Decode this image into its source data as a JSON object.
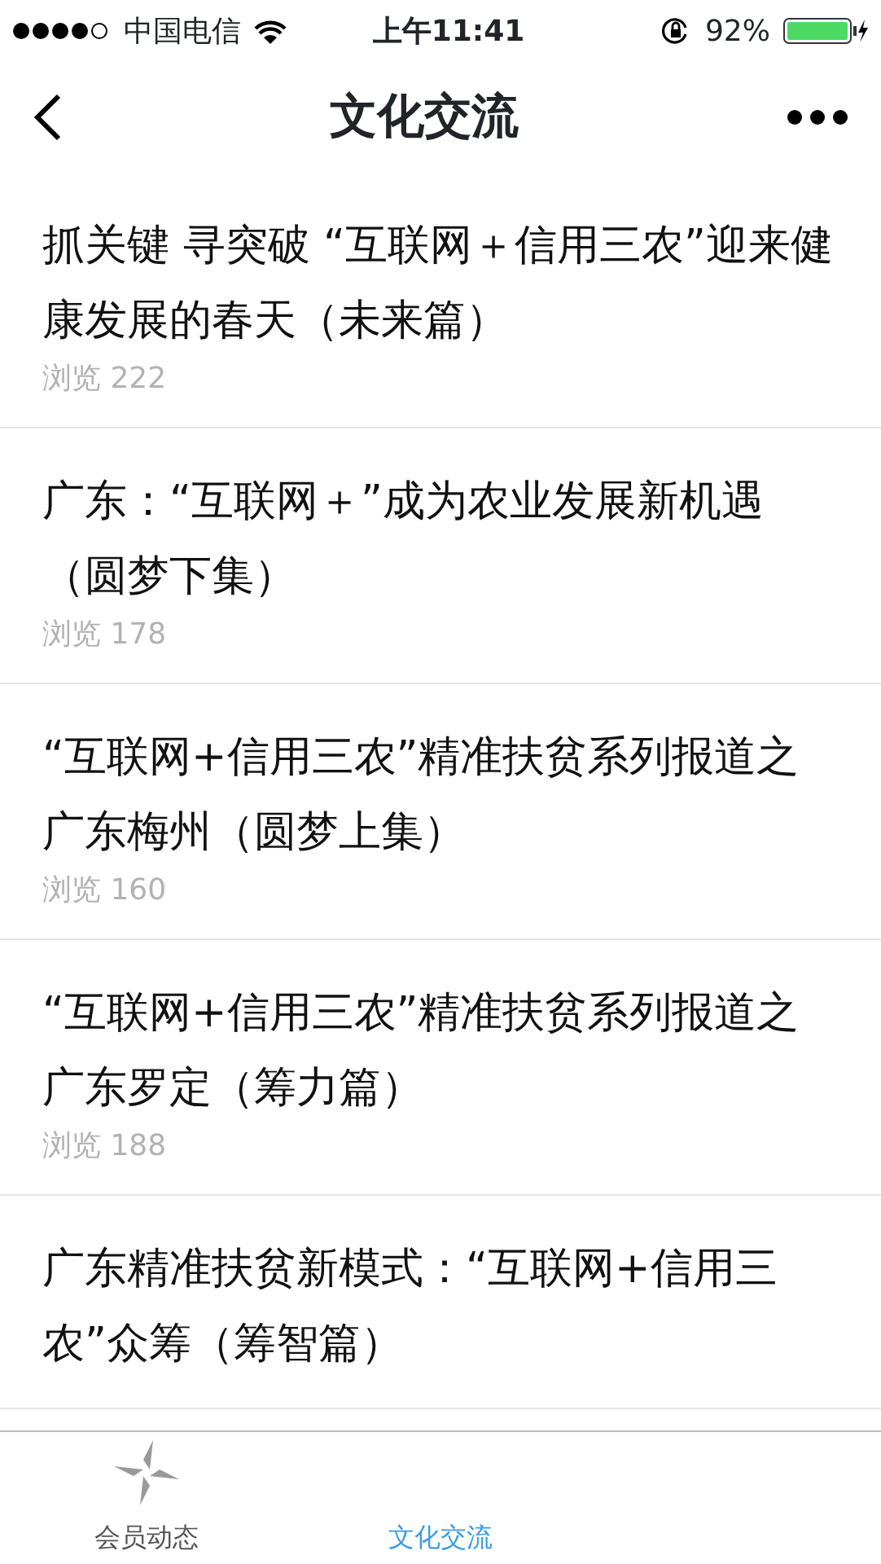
{
  "status_bar": {
    "carrier": "中国电信",
    "time": "上午11:41",
    "battery": "92%"
  },
  "nav": {
    "title": "文化交流"
  },
  "articles": [
    {
      "title": "抓关键 寻突破 “互联网＋信用三农”迎来健康发展的春天（未来篇）",
      "views": "浏览 222"
    },
    {
      "title": "广东：“互联网＋”成为农业发展新机遇（圆梦下集）",
      "views": "浏览 178"
    },
    {
      "title": "“互联网+信用三农”精准扶贫系列报道之广东梅州（圆梦上集）",
      "views": "浏览 160"
    },
    {
      "title": "“互联网+信用三农”精准扶贫系列报道之广东罗定（筹力篇）",
      "views": "浏览 188"
    },
    {
      "title": "广东精准扶贫新模式：“互联网+信用三农”众筹（筹智篇）"
    }
  ],
  "tab_bar": [
    {
      "label": "会员动态",
      "selected": false
    },
    {
      "label": "文化交流",
      "selected": true
    }
  ]
}
